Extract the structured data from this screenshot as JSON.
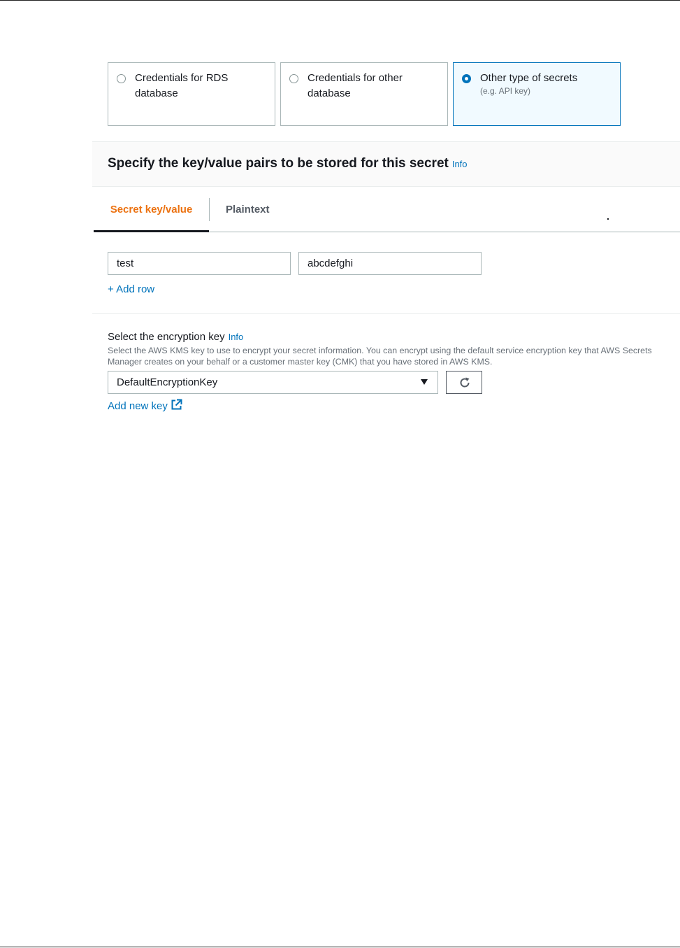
{
  "secret_type": {
    "options": [
      {
        "label": "Credentials for RDS database",
        "sublabel": "",
        "selected": false
      },
      {
        "label": "Credentials for other database",
        "sublabel": "",
        "selected": false
      },
      {
        "label": "Other type of secrets",
        "sublabel": "(e.g. API key)",
        "selected": true
      }
    ]
  },
  "section": {
    "title": "Specify the key/value pairs to be stored for this secret",
    "info": "Info"
  },
  "tabs": [
    {
      "label": "Secret key/value",
      "active": true
    },
    {
      "label": "Plaintext",
      "active": false
    }
  ],
  "kv": {
    "key": "test",
    "value": "abcdefghi",
    "add_row": "+ Add row"
  },
  "encryption": {
    "label": "Select the encryption key",
    "info": "Info",
    "description": "Select the AWS KMS key to use to encrypt your secret information. You can encrypt using the default service encryption key that AWS Secrets Manager creates on your behalf or a customer master key (CMK) that you have stored in AWS KMS.",
    "selected": "DefaultEncryptionKey",
    "add_key": "Add new key"
  },
  "icons": {
    "refresh": "refresh-icon",
    "external": "external-link-icon",
    "caret": "caret-down-icon"
  },
  "colors": {
    "link": "#0073bb",
    "active_tab": "#ec7211",
    "selected_card_bg": "#f1faff"
  }
}
